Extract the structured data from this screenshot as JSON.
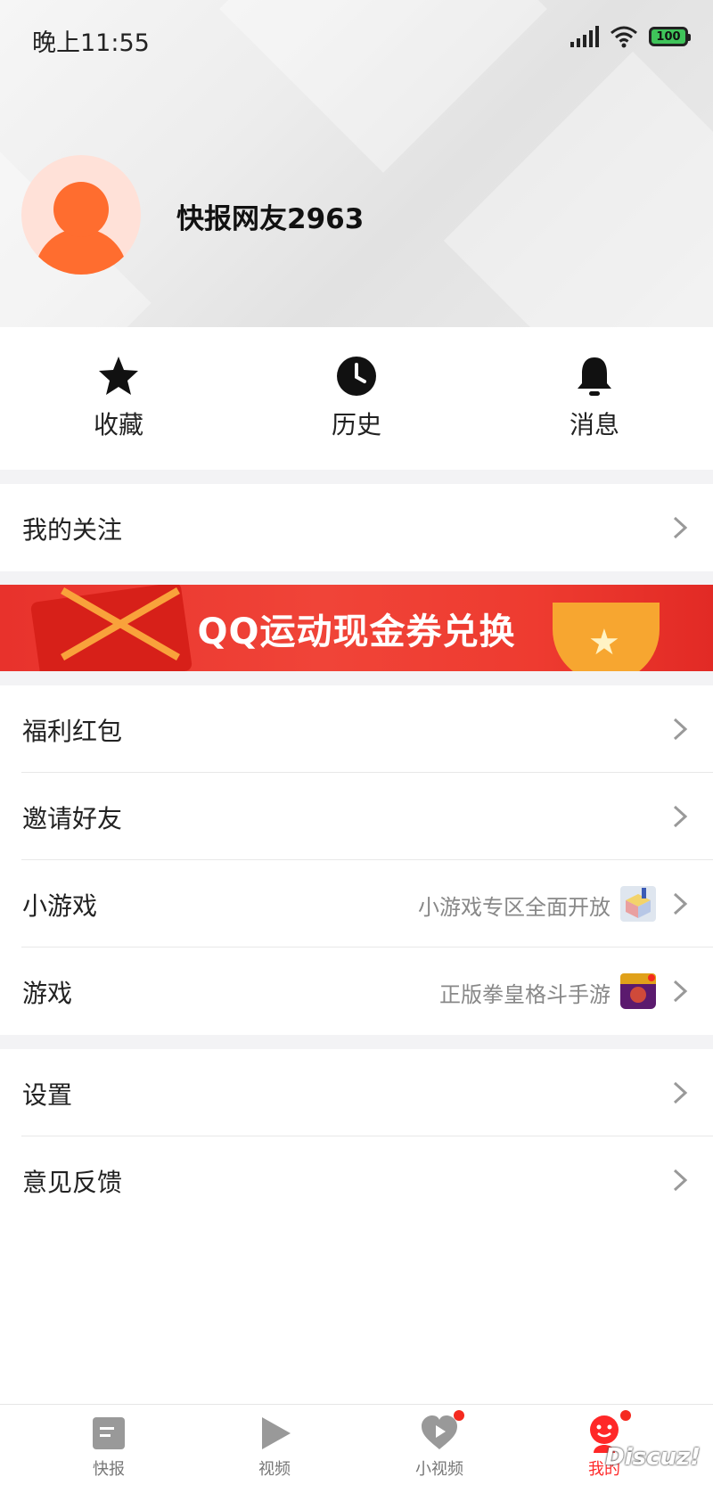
{
  "status_bar": {
    "time": "晚上11:55",
    "battery": "100"
  },
  "profile": {
    "username": "快报网友2963"
  },
  "quick_actions": [
    {
      "label": "收藏",
      "icon": "star-icon"
    },
    {
      "label": "历史",
      "icon": "clock-icon"
    },
    {
      "label": "消息",
      "icon": "bell-icon"
    }
  ],
  "follow": {
    "label": "我的关注"
  },
  "banner": {
    "text": "QQ运动现金券兑换"
  },
  "menu": [
    {
      "label": "福利红包",
      "hint": ""
    },
    {
      "label": "邀请好友",
      "hint": ""
    },
    {
      "label": "小游戏",
      "hint": "小游戏专区全面开放"
    },
    {
      "label": "游戏",
      "hint": "正版拳皇格斗手游"
    }
  ],
  "settings": [
    {
      "label": "设置"
    },
    {
      "label": "意见反馈"
    }
  ],
  "tabs": [
    {
      "label": "快报",
      "icon": "news-icon"
    },
    {
      "label": "视频",
      "icon": "play-icon"
    },
    {
      "label": "小视频",
      "icon": "heart-play-icon"
    },
    {
      "label": "我的",
      "icon": "profile-face-icon"
    }
  ],
  "watermark": "Discuz!",
  "colors": {
    "accent": "#ff2828",
    "avatar": "#ff6d2f",
    "banner": "#ee3b30"
  }
}
